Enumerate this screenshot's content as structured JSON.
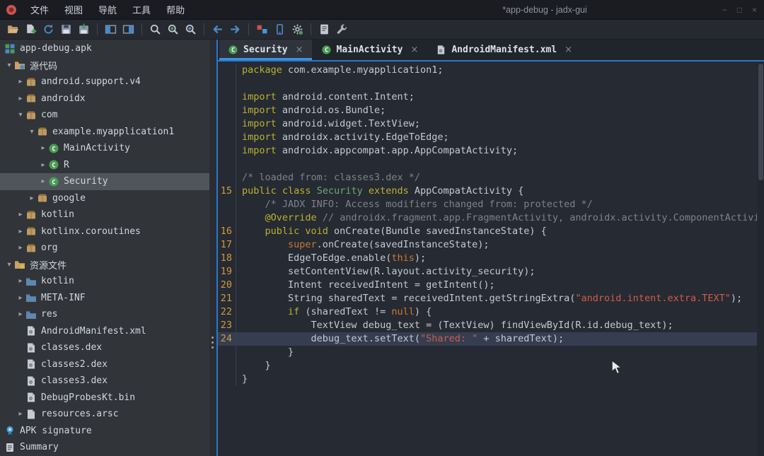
{
  "window": {
    "title": "*app-debug - jadx-gui",
    "controls": [
      "−",
      "□",
      "×"
    ]
  },
  "menubar": {
    "items": [
      {
        "name": "file",
        "label": "文件"
      },
      {
        "name": "view",
        "label": "视图"
      },
      {
        "name": "navigation",
        "label": "导航"
      },
      {
        "name": "tools",
        "label": "工具"
      },
      {
        "name": "help",
        "label": "帮助"
      }
    ]
  },
  "toolbar": {
    "buttons": [
      "open-file",
      "add-files",
      "reload",
      "save-all",
      "export",
      "sep",
      "panels",
      "sync",
      "sep",
      "search-text",
      "search-class",
      "search-usage",
      "sep",
      "nav-back",
      "nav-forward",
      "sep",
      "deobfuscation",
      "device",
      "settings",
      "sep",
      "log-viewer",
      "preferences"
    ]
  },
  "tabs": [
    {
      "name": "security",
      "label": "Security",
      "icon": "cls",
      "active": true,
      "close": "×"
    },
    {
      "name": "mainactivity",
      "label": "MainActivity",
      "icon": "cls",
      "active": false,
      "close": "×"
    },
    {
      "name": "androidmanifest-xml",
      "label": "AndroidManifest.xml",
      "icon": "file",
      "active": false,
      "close": "×"
    }
  ],
  "tree": {
    "items": [
      {
        "id": "app-debug-apk",
        "level": 0,
        "chev": "none",
        "sp": false,
        "icon": "apk",
        "label": "app-debug.apk"
      },
      {
        "id": "source-code",
        "level": 0,
        "chev": "v",
        "sp": true,
        "icon": "src",
        "label": "源代码"
      },
      {
        "id": "android-support-v4",
        "level": 1,
        "chev": ">",
        "sp": true,
        "icon": "pkg",
        "label": "android.support.v4"
      },
      {
        "id": "androidx",
        "level": 1,
        "chev": ">",
        "sp": true,
        "icon": "pkg",
        "label": "androidx"
      },
      {
        "id": "com",
        "level": 1,
        "chev": "v",
        "sp": true,
        "icon": "pkg",
        "label": "com"
      },
      {
        "id": "example-myapplication1",
        "level": 2,
        "chev": "v",
        "sp": true,
        "icon": "pkg",
        "label": "example.myapplication1"
      },
      {
        "id": "mainactivity",
        "level": 3,
        "chev": ">",
        "sp": true,
        "icon": "cls",
        "label": "MainActivity"
      },
      {
        "id": "r",
        "level": 3,
        "chev": ">",
        "sp": true,
        "icon": "cls",
        "label": "R"
      },
      {
        "id": "security",
        "level": 3,
        "chev": ">",
        "sp": true,
        "icon": "cls",
        "label": "Security",
        "selected": true
      },
      {
        "id": "google",
        "level": 2,
        "chev": ">",
        "sp": true,
        "icon": "pkg",
        "label": "google"
      },
      {
        "id": "kotlin-pkg",
        "level": 1,
        "chev": ">",
        "sp": true,
        "icon": "pkg",
        "label": "kotlin"
      },
      {
        "id": "kotlinx-coroutines",
        "level": 1,
        "chev": ">",
        "sp": true,
        "icon": "pkg",
        "label": "kotlinx.coroutines"
      },
      {
        "id": "org",
        "level": 1,
        "chev": ">",
        "sp": true,
        "icon": "pkg",
        "label": "org"
      },
      {
        "id": "resources",
        "level": 0,
        "chev": "v",
        "sp": true,
        "icon": "res",
        "label": "资源文件"
      },
      {
        "id": "kotlin-folder",
        "level": 1,
        "chev": ">",
        "sp": true,
        "icon": "folder",
        "label": "kotlin"
      },
      {
        "id": "meta-inf",
        "level": 1,
        "chev": ">",
        "sp": true,
        "icon": "folder",
        "label": "META-INF"
      },
      {
        "id": "res",
        "level": 1,
        "chev": ">",
        "sp": true,
        "icon": "folder",
        "label": "res"
      },
      {
        "id": "androidmanifest-xml",
        "level": 1,
        "chev": "none",
        "sp": true,
        "icon": "file",
        "label": "AndroidManifest.xml"
      },
      {
        "id": "classes-dex",
        "level": 1,
        "chev": "none",
        "sp": true,
        "icon": "file",
        "label": "classes.dex"
      },
      {
        "id": "classes2-dex",
        "level": 1,
        "chev": "none",
        "sp": true,
        "icon": "file",
        "label": "classes2.dex"
      },
      {
        "id": "classes3-dex",
        "level": 1,
        "chev": "none",
        "sp": true,
        "icon": "file",
        "label": "classes3.dex"
      },
      {
        "id": "debugprobeskt-bin",
        "level": 1,
        "chev": "none",
        "sp": true,
        "icon": "file",
        "label": "DebugProbesKt.bin"
      },
      {
        "id": "resources-arsc",
        "level": 1,
        "chev": ">",
        "sp": true,
        "icon": "page",
        "label": "resources.arsc"
      },
      {
        "id": "apk-signature",
        "level": 0,
        "chev": "none",
        "sp": false,
        "icon": "cert",
        "label": "APK signature"
      },
      {
        "id": "summary",
        "level": 0,
        "chev": "none",
        "sp": false,
        "icon": "sum",
        "label": "Summary"
      }
    ]
  },
  "editor": {
    "lines": [
      {
        "n": "",
        "h": false,
        "s": [
          [
            "kw",
            "package"
          ],
          [
            "pl",
            " com.example.myapplication1;"
          ]
        ]
      },
      {
        "n": "",
        "h": false,
        "s": []
      },
      {
        "n": "",
        "h": false,
        "s": [
          [
            "kw",
            "import"
          ],
          [
            "pl",
            " android.content.Intent;"
          ]
        ]
      },
      {
        "n": "",
        "h": false,
        "s": [
          [
            "kw",
            "import"
          ],
          [
            "pl",
            " android.os.Bundle;"
          ]
        ]
      },
      {
        "n": "",
        "h": false,
        "s": [
          [
            "kw",
            "import"
          ],
          [
            "pl",
            " android.widget.TextView;"
          ]
        ]
      },
      {
        "n": "",
        "h": false,
        "s": [
          [
            "kw",
            "import"
          ],
          [
            "pl",
            " androidx.activity.EdgeToEdge;"
          ]
        ]
      },
      {
        "n": "",
        "h": false,
        "s": [
          [
            "kw",
            "import"
          ],
          [
            "pl",
            " androidx.appcompat.app.AppCompatActivity;"
          ]
        ]
      },
      {
        "n": "",
        "h": false,
        "s": []
      },
      {
        "n": "",
        "h": false,
        "s": [
          [
            "com",
            "/* loaded from: classes3.dex */"
          ]
        ]
      },
      {
        "n": "15",
        "h": false,
        "s": [
          [
            "kw",
            "public class"
          ],
          [
            "pl",
            " "
          ],
          [
            "cls",
            "Security"
          ],
          [
            "pl",
            " "
          ],
          [
            "kw",
            "extends"
          ],
          [
            "pl",
            " AppCompatActivity {"
          ]
        ]
      },
      {
        "n": "",
        "h": false,
        "s": [
          [
            "com",
            "    /* JADX INFO: Access modifiers changed from: protected */"
          ]
        ]
      },
      {
        "n": "",
        "h": false,
        "s": [
          [
            "pl",
            "    "
          ],
          [
            "kw",
            "@Override"
          ],
          [
            "pl",
            " "
          ],
          [
            "com",
            "// androidx.fragment.app.FragmentActivity, androidx.activity.ComponentActivity, androidx.core.app.ComponentActivity"
          ]
        ]
      },
      {
        "n": "16",
        "h": false,
        "s": [
          [
            "pl",
            "    "
          ],
          [
            "kw",
            "public void"
          ],
          [
            "pl",
            " onCreate(Bundle savedInstanceState) {"
          ]
        ]
      },
      {
        "n": "17",
        "h": false,
        "s": [
          [
            "pl",
            "        "
          ],
          [
            "kw2",
            "super"
          ],
          [
            "pl",
            ".onCreate(savedInstanceState);"
          ]
        ]
      },
      {
        "n": "18",
        "h": false,
        "s": [
          [
            "pl",
            "        EdgeToEdge.enable("
          ],
          [
            "kw2",
            "this"
          ],
          [
            "pl",
            ");"
          ]
        ]
      },
      {
        "n": "19",
        "h": false,
        "s": [
          [
            "pl",
            "        setContentView(R.layout.activity_security);"
          ]
        ]
      },
      {
        "n": "20",
        "h": false,
        "s": [
          [
            "pl",
            "        Intent receivedIntent = getIntent();"
          ]
        ]
      },
      {
        "n": "21",
        "h": false,
        "s": [
          [
            "pl",
            "        String sharedText = receivedIntent.getStringExtra("
          ],
          [
            "str",
            "\"android.intent.extra.TEXT\""
          ],
          [
            "pl",
            ");"
          ]
        ]
      },
      {
        "n": "22",
        "h": false,
        "s": [
          [
            "pl",
            "        "
          ],
          [
            "kw",
            "if"
          ],
          [
            "pl",
            " (sharedText != "
          ],
          [
            "kw2",
            "null"
          ],
          [
            "pl",
            ") {"
          ]
        ]
      },
      {
        "n": "23",
        "h": false,
        "s": [
          [
            "pl",
            "            TextView debug_text = (TextView) findViewById(R.id.debug_text);"
          ]
        ]
      },
      {
        "n": "24",
        "h": true,
        "s": [
          [
            "pl",
            "            debug_text.setText("
          ],
          [
            "str",
            "\"Shared: \""
          ],
          [
            "pl",
            " + sharedText);"
          ]
        ]
      },
      {
        "n": "",
        "h": false,
        "s": [
          [
            "pl",
            "        }"
          ]
        ]
      },
      {
        "n": "",
        "h": false,
        "s": [
          [
            "pl",
            "    }"
          ]
        ]
      },
      {
        "n": "",
        "h": false,
        "s": [
          [
            "pl",
            "}"
          ]
        ]
      }
    ]
  },
  "colors": {
    "accent": "#3b93dd",
    "border_blue": "#2c77cc",
    "keyword": "#b9b231",
    "keyword_alt": "#cc7832",
    "string": "#d05c4a",
    "comment": "#7d828c",
    "class_name": "#6aab73",
    "line_number": "#d19a3f",
    "line_highlight": "#353e50",
    "tree_selection": "#50555c"
  }
}
